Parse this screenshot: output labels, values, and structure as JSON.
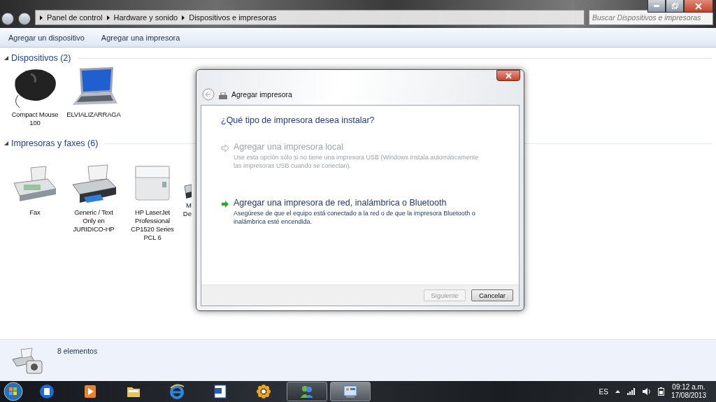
{
  "window": {
    "breadcrumb": [
      "Panel de control",
      "Hardware y sonido",
      "Dispositivos e impresoras"
    ],
    "search": {
      "placeholder": "Buscar Dispositivos e impresoras"
    }
  },
  "toolbar": [
    "Agregar un dispositivo",
    "Agregar una impresora"
  ],
  "groups": [
    {
      "title": "Dispositivos (2)",
      "expanded": true,
      "items": [
        {
          "kind": "mouse",
          "label": "Compact Mouse 100"
        },
        {
          "kind": "laptop",
          "label": "ELVIALIZARRAGA"
        }
      ]
    },
    {
      "title": "Impresoras y faxes (6)",
      "expanded": true,
      "items": [
        {
          "kind": "fax",
          "label": "Fax"
        },
        {
          "kind": "printer",
          "label": "Generic / Text Only en JURIDICO-HP"
        },
        {
          "kind": "laser",
          "label": "HP LaserJet Professional CP1520 Series PCL 6"
        },
        {
          "kind": "printer",
          "label": "M De",
          "partial": true
        }
      ]
    }
  ],
  "dialog": {
    "title": "Agregar impresora",
    "heading": "¿Qué tipo de impresora desea instalar?",
    "options": [
      {
        "title": "Agregar una impresora local",
        "description": "Use esta opción sólo si no tiene una impresora USB (Windows instala automáticamente las impresoras USB cuando se conectan).",
        "disabled": true
      },
      {
        "title": "Agregar una impresora de red, inalámbrica o Bluetooth",
        "description": "Asegúrese de que el equipo está conectado a la red o de que la impresora Bluetooth o inalámbrica esté encendida.",
        "disabled": false
      }
    ],
    "buttons": [
      {
        "label": "Siguiente",
        "disabled": true
      },
      {
        "label": "Cancelar",
        "disabled": false
      }
    ]
  },
  "status_bar": {
    "count": "8 elementos"
  },
  "taskbar": {
    "apps": [
      {
        "kind": "center",
        "running": false,
        "selected": false
      },
      {
        "kind": "player",
        "running": false,
        "selected": false
      },
      {
        "kind": "folder",
        "running": false,
        "selected": false
      },
      {
        "kind": "browser",
        "running": false,
        "selected": false
      },
      {
        "kind": "word",
        "running": false,
        "selected": false
      },
      {
        "kind": "flower",
        "running": false,
        "selected": false
      },
      {
        "kind": "messenger",
        "running": true,
        "selected": false
      },
      {
        "kind": "panel",
        "running": true,
        "selected": true
      }
    ],
    "language": "ES",
    "time": "09:12 a.m.",
    "date": "17/08/2013"
  }
}
